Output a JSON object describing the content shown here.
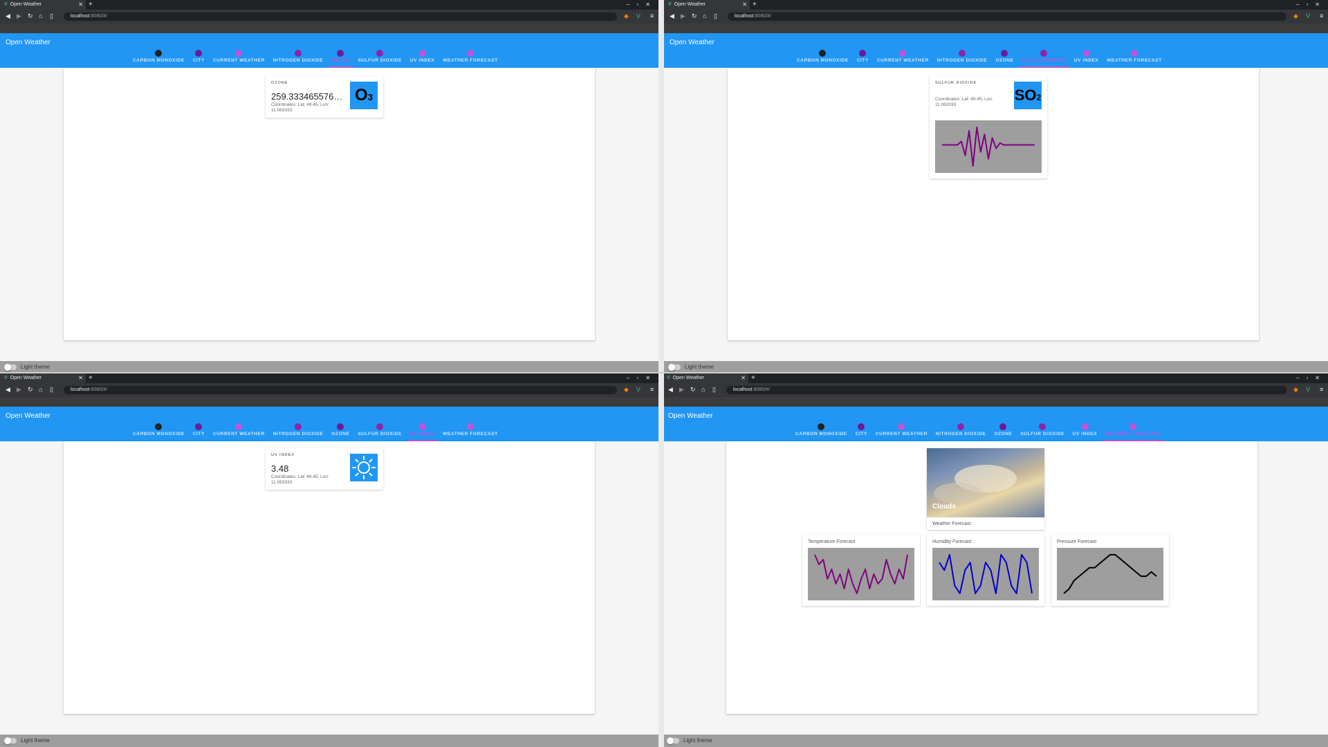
{
  "browser": {
    "tab_title": "Open Weather",
    "url_host": "localhost",
    "url_path": ":8080/#/"
  },
  "app": {
    "title": "Open Weather",
    "footer_label": "Light theme",
    "nav_tabs": [
      {
        "label": "CARBON MONOXIDE",
        "icon": "cloud-icon"
      },
      {
        "label": "CITY",
        "icon": "city-icon"
      },
      {
        "label": "CURRENT WEATHER",
        "icon": "weather-icon"
      },
      {
        "label": "NITROGEN DIOXIDE",
        "icon": "no2-icon"
      },
      {
        "label": "OZONE",
        "icon": "o3-icon"
      },
      {
        "label": "SULFUR DIOXIDE",
        "icon": "so2-icon"
      },
      {
        "label": "UV INDEX",
        "icon": "uv-icon"
      },
      {
        "label": "WEATHER FORECAST",
        "icon": "forecast-icon"
      }
    ]
  },
  "ozone": {
    "overline": "OZONE",
    "value": "259.33346557617...",
    "coords": "Coordinates: Lat: 49.45, Lon: 11.083333",
    "formula": "O",
    "formula_sub": "3"
  },
  "sulfur": {
    "overline": "SULFUR DIOXIDE",
    "coords": "Coordinates: Lat: 49.45, Lon: 11.083333",
    "formula": "SO",
    "formula_sub": "2"
  },
  "uv": {
    "overline": "UV INDEX",
    "value": "3.48",
    "coords": "Coordinates: Lat: 49.45, Lon: 11.083333"
  },
  "forecast": {
    "image_caption": "Clouds",
    "card_subtitle": "Weather Forecast",
    "temperature_title": "Temperature Forecast",
    "humidity_title": "Humidity Forecast",
    "pressure_title": "Pressure Forecast"
  },
  "chart_data": [
    {
      "type": "line",
      "title": "",
      "series": [
        {
          "values": [
            0,
            0,
            0,
            0,
            0,
            2,
            -6,
            8,
            -12,
            10,
            -4,
            6,
            -8,
            4,
            -2,
            1,
            0,
            0,
            0,
            0,
            0,
            0,
            0,
            0,
            0
          ]
        }
      ],
      "color": "#800080"
    },
    {
      "type": "line",
      "title": "Temperature Forecast",
      "series": [
        {
          "values": [
            9,
            7,
            8,
            4,
            6,
            3,
            5,
            2,
            6,
            3,
            1,
            4,
            6,
            2,
            5,
            3,
            4,
            8,
            5,
            3,
            6,
            4,
            9
          ]
        }
      ],
      "color": "#800080"
    },
    {
      "type": "line",
      "title": "Humidity Forecast",
      "series": [
        {
          "values": [
            6,
            5,
            7,
            3,
            2,
            5,
            6,
            2,
            3,
            6,
            5,
            2,
            7,
            6,
            3,
            2,
            7,
            6,
            2
          ]
        }
      ],
      "color": "#0000cc"
    },
    {
      "type": "line",
      "title": "Pressure Forecast",
      "series": [
        {
          "values": [
            1,
            2,
            4,
            5,
            6,
            7,
            7,
            8,
            9,
            10,
            10,
            9,
            8,
            7,
            6,
            5,
            5,
            6,
            5
          ]
        }
      ],
      "color": "#000000"
    }
  ]
}
